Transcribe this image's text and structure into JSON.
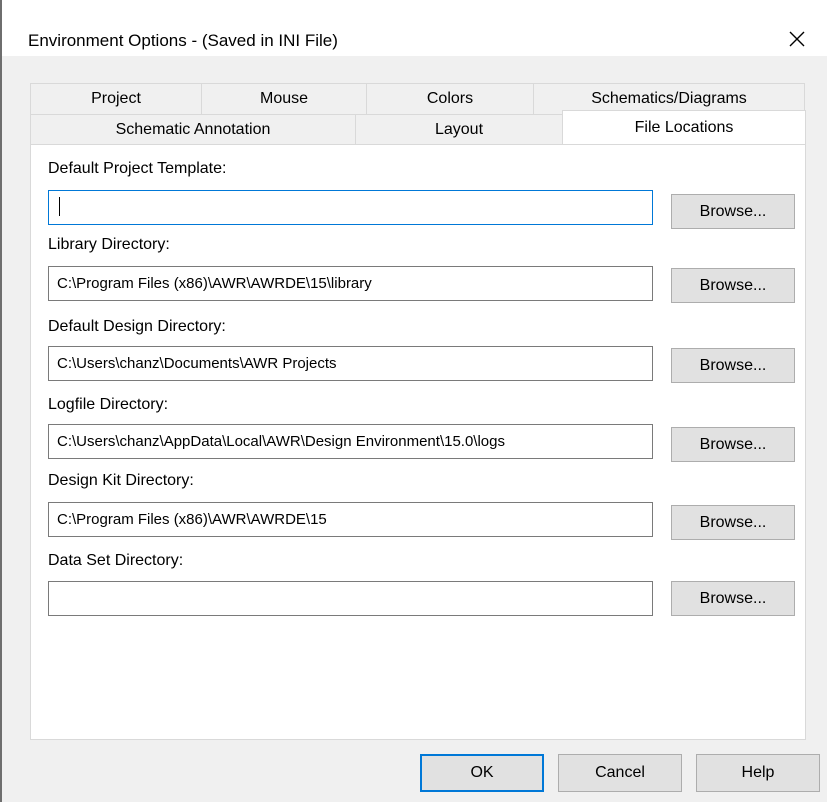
{
  "window": {
    "title": "Environment Options - (Saved in INI File)"
  },
  "tabs": {
    "row1": [
      "Project",
      "Mouse",
      "Colors",
      "Schematics/Diagrams"
    ],
    "row2": [
      "Schematic Annotation",
      "Layout",
      "File Locations"
    ],
    "active": "File Locations"
  },
  "fields": [
    {
      "label": "Default Project Template:",
      "value": "",
      "focused": true
    },
    {
      "label": "Library Directory:",
      "value": "C:\\Program Files (x86)\\AWR\\AWRDE\\15\\library"
    },
    {
      "label": "Default Design Directory:",
      "value": "C:\\Users\\chanz\\Documents\\AWR Projects"
    },
    {
      "label": "Logfile Directory:",
      "value": "C:\\Users\\chanz\\AppData\\Local\\AWR\\Design Environment\\15.0\\logs"
    },
    {
      "label": "Design Kit Directory:",
      "value": "C:\\Program Files (x86)\\AWR\\AWRDE\\15"
    },
    {
      "label": "Data Set Directory:",
      "value": ""
    }
  ],
  "browse_label": "Browse...",
  "buttons": {
    "ok": "OK",
    "cancel": "Cancel",
    "help": "Help"
  },
  "colors": {
    "focus_accent": "#0078d7",
    "button_face": "#e1e1e1"
  }
}
